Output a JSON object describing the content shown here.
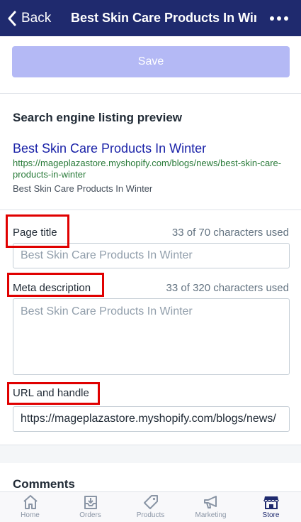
{
  "header": {
    "back_label": "Back",
    "title": "Best Skin Care Products In Winter"
  },
  "toolbar": {
    "save_label": "Save"
  },
  "preview": {
    "heading": "Search engine listing preview",
    "title": "Best Skin Care Products In Winter",
    "url": "https://mageplazastore.myshopify.com/blogs/news/best-skin-care-products-in-winter",
    "description": "Best Skin Care Products In Winter"
  },
  "fields": {
    "page_title": {
      "label": "Page title",
      "count": "33 of 70 characters used",
      "placeholder": "Best Skin Care Products In Winter"
    },
    "meta_description": {
      "label": "Meta description",
      "count": "33 of 320 characters used",
      "placeholder": "Best Skin Care Products In Winter"
    },
    "url_handle": {
      "label": "URL and handle",
      "value": "https://mageplazastore.myshopify.com/blogs/news/"
    }
  },
  "comments": {
    "title": "Comments"
  },
  "nav": {
    "items": [
      {
        "label": "Home",
        "icon": "home-icon"
      },
      {
        "label": "Orders",
        "icon": "orders-icon"
      },
      {
        "label": "Products",
        "icon": "tag-icon"
      },
      {
        "label": "Marketing",
        "icon": "megaphone-icon"
      },
      {
        "label": "Store",
        "icon": "store-icon"
      }
    ],
    "active": "Store"
  },
  "colors": {
    "header_bg": "#1f2a6e",
    "save_button": "#b4b9f5",
    "link": "#1a22a8",
    "url_green": "#287a38",
    "highlight_red": "#e00000"
  }
}
